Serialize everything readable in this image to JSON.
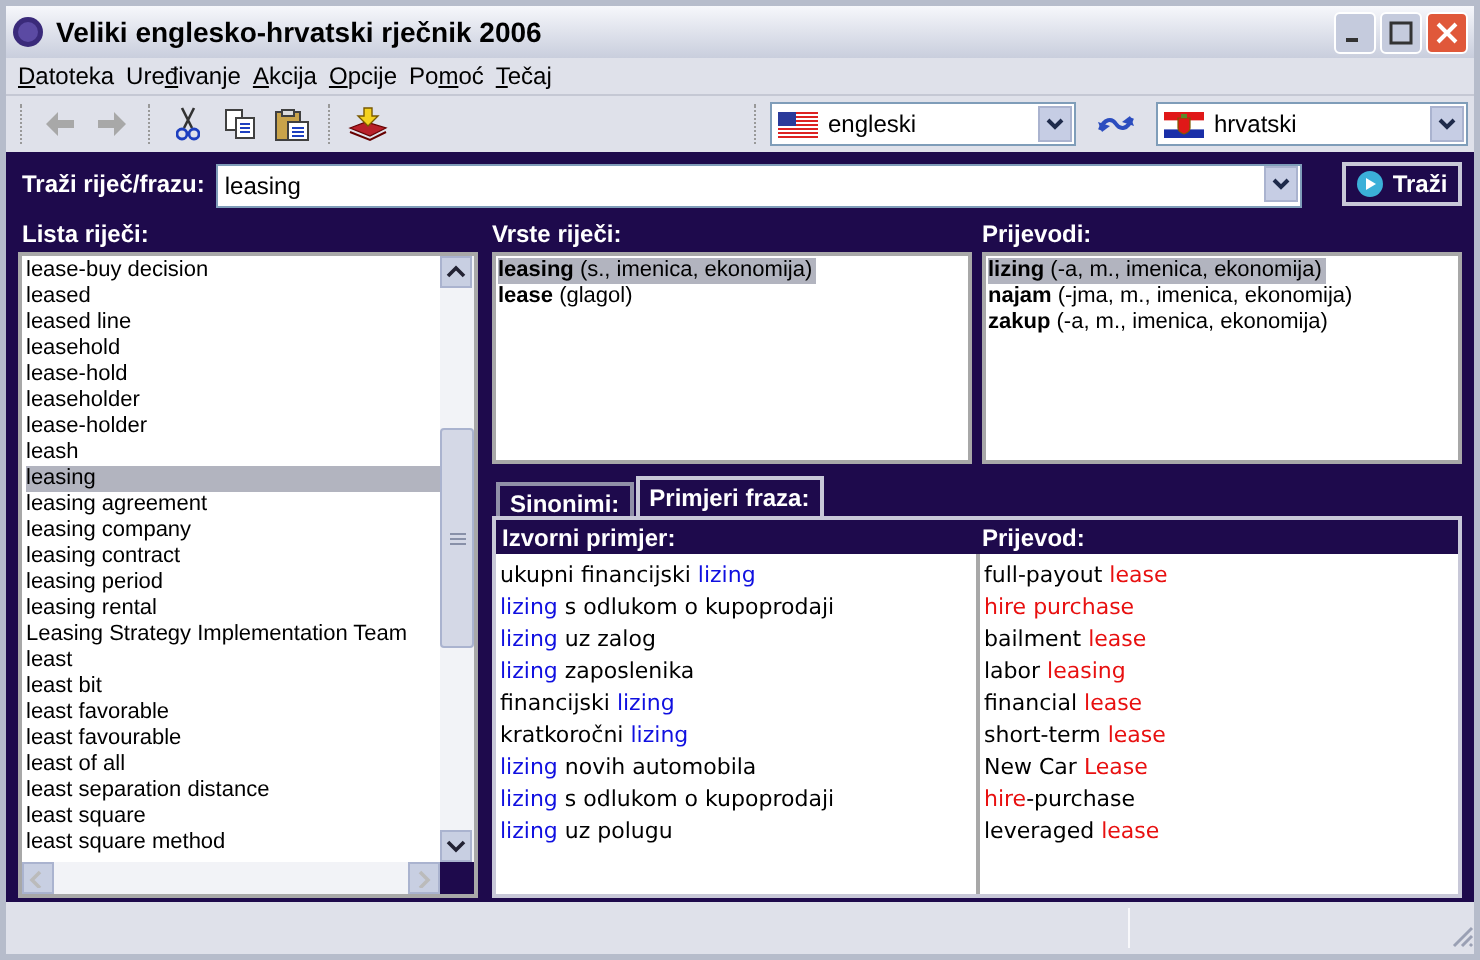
{
  "window": {
    "title": "Veliki englesko-hrvatski rječnik 2006"
  },
  "menu": [
    {
      "parts": [
        {
          "text": "D",
          "underline": true
        },
        {
          "text": "atoteka",
          "underline": false
        }
      ]
    },
    {
      "parts": [
        {
          "text": "Ure",
          "underline": false
        },
        {
          "text": "đ",
          "underline": true
        },
        {
          "text": "ivanje",
          "underline": false
        }
      ]
    },
    {
      "parts": [
        {
          "text": "A",
          "underline": true
        },
        {
          "text": "kcija",
          "underline": false
        }
      ]
    },
    {
      "parts": [
        {
          "text": "O",
          "underline": true
        },
        {
          "text": "pcije",
          "underline": false
        }
      ]
    },
    {
      "parts": [
        {
          "text": "Po",
          "underline": false
        },
        {
          "text": "m",
          "underline": true
        },
        {
          "text": "oć",
          "underline": false
        }
      ]
    },
    {
      "parts": [
        {
          "text": "T",
          "underline": true
        },
        {
          "text": "ečaj",
          "underline": false
        }
      ]
    }
  ],
  "toolbar": {
    "buttons": [
      {
        "kind": "back",
        "disabled": true
      },
      {
        "kind": "forward",
        "disabled": true
      },
      {
        "kind": "cut",
        "disabled": false
      },
      {
        "kind": "copy",
        "disabled": false
      },
      {
        "kind": "paste",
        "disabled": false
      },
      {
        "kind": "import",
        "disabled": false
      }
    ],
    "source_language": "engleski",
    "target_language": "hrvatski"
  },
  "search": {
    "label": "Traži riječ/frazu:",
    "value": "leasing",
    "button": "Traži"
  },
  "word_list": {
    "title": "Lista riječi:",
    "items": [
      {
        "text": "lease-buy decision",
        "selected": false
      },
      {
        "text": "leased",
        "selected": false
      },
      {
        "text": "leased line",
        "selected": false
      },
      {
        "text": "leasehold",
        "selected": false
      },
      {
        "text": "lease-hold",
        "selected": false
      },
      {
        "text": "leaseholder",
        "selected": false
      },
      {
        "text": "lease-holder",
        "selected": false
      },
      {
        "text": "leash",
        "selected": false
      },
      {
        "text": "leasing",
        "selected": true
      },
      {
        "text": "leasing agreement",
        "selected": false
      },
      {
        "text": "leasing company",
        "selected": false
      },
      {
        "text": "leasing contract",
        "selected": false
      },
      {
        "text": "leasing period",
        "selected": false
      },
      {
        "text": "leasing rental",
        "selected": false
      },
      {
        "text": "Leasing Strategy Implementation Team",
        "selected": false
      },
      {
        "text": "least",
        "selected": false
      },
      {
        "text": "least bit",
        "selected": false
      },
      {
        "text": "least favorable",
        "selected": false
      },
      {
        "text": "least favourable",
        "selected": false
      },
      {
        "text": "least of all",
        "selected": false
      },
      {
        "text": "least separation distance",
        "selected": false
      },
      {
        "text": "least square",
        "selected": false
      },
      {
        "text": "least square method",
        "selected": false
      }
    ]
  },
  "word_types": {
    "title": "Vrste riječi:",
    "items": [
      {
        "text": "**leasing** (s., imenica, ekonomija)",
        "selected": true
      },
      {
        "text": "**lease** (glagol)",
        "selected": false
      }
    ]
  },
  "translations": {
    "title": "Prijevodi:",
    "items": [
      {
        "text": "**lizing** (-a, m., imenica, ekonomija)",
        "selected": true
      },
      {
        "text": "**najam** (-jma, m., imenica, ekonomija)",
        "selected": false
      },
      {
        "text": "**zakup** (-a, m., imenica, ekonomija)",
        "selected": false
      }
    ]
  },
  "tabs": [
    {
      "label": "Sinonimi:",
      "selected": false
    },
    {
      "label": "Primjeri fraza:",
      "selected": true
    }
  ],
  "phrases": {
    "columns": [
      "Izvorni primjer:",
      "Prijevod:"
    ],
    "rows": [
      {
        "source": [
          {
            "text": "ukupni financijski ",
            "match": false
          },
          {
            "text": "lizing",
            "match": true
          }
        ],
        "translation": [
          {
            "text": "full-payout ",
            "match": false
          },
          {
            "text": "lease",
            "match": true
          }
        ]
      },
      {
        "source": [
          {
            "text": "lizing",
            "match": true
          },
          {
            "text": " s odlukom o kupoprodaji",
            "match": false
          }
        ],
        "translation": [
          {
            "text": "hire purchase",
            "match": true
          }
        ]
      },
      {
        "source": [
          {
            "text": "lizing",
            "match": true
          },
          {
            "text": " uz zalog",
            "match": false
          }
        ],
        "translation": [
          {
            "text": "bailment ",
            "match": false
          },
          {
            "text": "lease",
            "match": true
          }
        ]
      },
      {
        "source": [
          {
            "text": "lizing",
            "match": true
          },
          {
            "text": " zaposlenika",
            "match": false
          }
        ],
        "translation": [
          {
            "text": "labor ",
            "match": false
          },
          {
            "text": "leasing",
            "match": true
          }
        ]
      },
      {
        "source": [
          {
            "text": "financijski ",
            "match": false
          },
          {
            "text": "lizing",
            "match": true
          }
        ],
        "translation": [
          {
            "text": "financial ",
            "match": false
          },
          {
            "text": "lease",
            "match": true
          }
        ]
      },
      {
        "source": [
          {
            "text": "kratkoročni ",
            "match": false
          },
          {
            "text": "lizing",
            "match": true
          }
        ],
        "translation": [
          {
            "text": "short-term ",
            "match": false
          },
          {
            "text": "lease",
            "match": true
          }
        ]
      },
      {
        "source": [
          {
            "text": "lizing",
            "match": true
          },
          {
            "text": " novih automobila",
            "match": false
          }
        ],
        "translation": [
          {
            "text": "New Car ",
            "match": false
          },
          {
            "text": "Lease",
            "match": true
          }
        ]
      },
      {
        "source": [
          {
            "text": "lizing",
            "match": true
          },
          {
            "text": " s odlukom o kupoprodaji",
            "match": false
          }
        ],
        "translation": [
          {
            "text": "hire",
            "match": true
          },
          {
            "text": "-purchase",
            "match": false
          }
        ]
      },
      {
        "source": [
          {
            "text": "lizing",
            "match": true
          },
          {
            "text": " uz polugu",
            "match": false
          }
        ],
        "translation": [
          {
            "text": "leveraged ",
            "match": false
          },
          {
            "text": "lease",
            "match": true
          }
        ]
      }
    ]
  }
}
